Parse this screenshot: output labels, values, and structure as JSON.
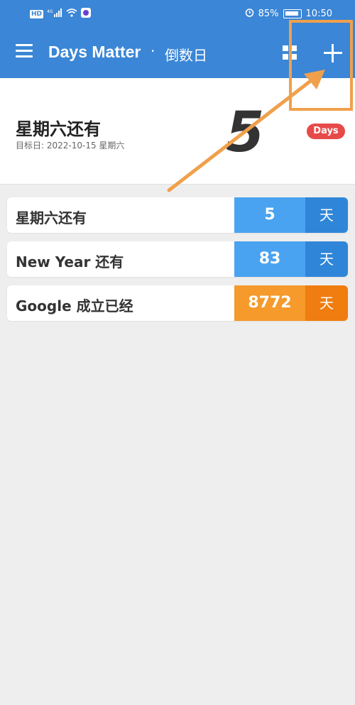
{
  "status_bar": {
    "left_badge": "HD",
    "network": "4G",
    "battery_percent": "85%",
    "time": "10:50"
  },
  "app_bar": {
    "title": "Days Matter",
    "separator": "·",
    "subtitle": "倒数日",
    "icons": [
      "menu-icon",
      "grid-icon",
      "add-icon"
    ]
  },
  "hero": {
    "title": "星期六还有",
    "date_line": "目标日: 2022-10-15 星期六",
    "number": "5",
    "badge": "Days"
  },
  "events": [
    {
      "label": "星期六还有",
      "count": "5",
      "unit": "天",
      "count_color": "#4aa3f0",
      "unit_color": "#2f86d8"
    },
    {
      "label": "New Year 还有",
      "count": "83",
      "unit": "天",
      "count_color": "#4aa3f0",
      "unit_color": "#2f86d8"
    },
    {
      "label": "Google 成立已经",
      "count": "8772",
      "unit": "天",
      "count_color": "#f59a2b",
      "unit_color": "#f07d0f"
    }
  ],
  "colors": {
    "primary": "#3b86d6",
    "annotation": "#f0a04b",
    "badge_red": "#e74a4a"
  }
}
